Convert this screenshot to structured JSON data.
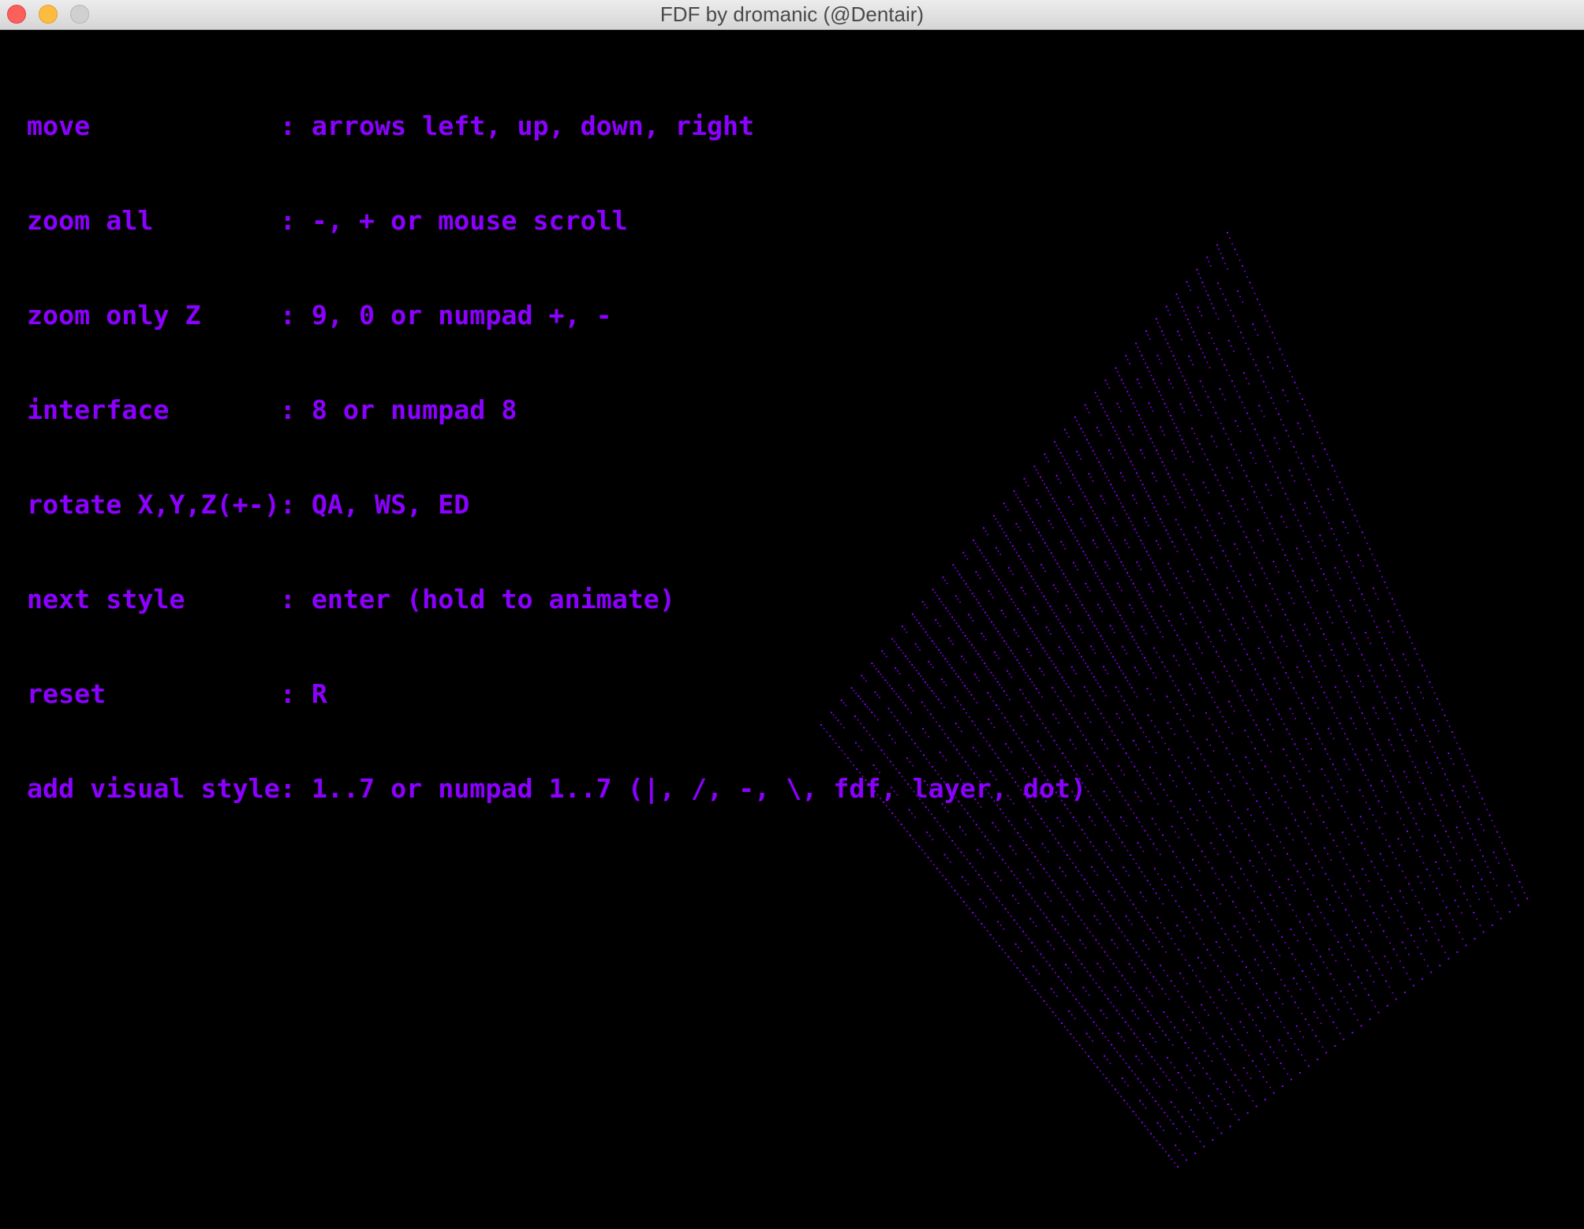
{
  "window": {
    "title": "FDF by dromanic (@Dentair)"
  },
  "colors": {
    "text": "#8b00ff",
    "mesh": "#8b00ff",
    "background": "#000000"
  },
  "help": {
    "lines": [
      "move            : arrows left, up, down, right",
      "zoom all        : -, + or mouse scroll",
      "zoom only Z     : 9, 0 or numpad +, -",
      "interface       : 8 or numpad 8",
      "rotate X,Y,Z(+-): QA, WS, ED",
      "next style      : enter (hold to animate)",
      "reset           : R",
      "add visual style: 1..7 or numpad 1..7 (|, /, -, \\, fdf, layer, dot)"
    ]
  },
  "mesh": {
    "style": "dot",
    "pattern": "concentric squares (pyramid)"
  }
}
